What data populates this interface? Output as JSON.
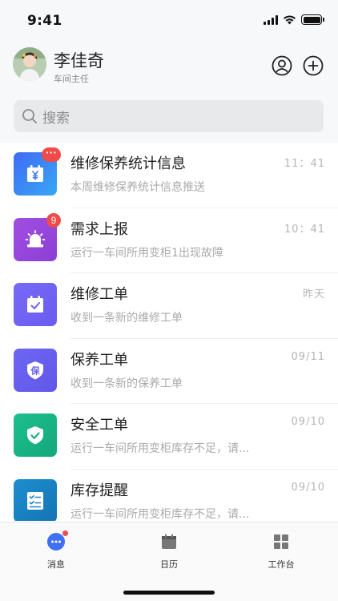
{
  "status_bar": {
    "time": "9:41"
  },
  "header": {
    "user_name": "李佳奇",
    "user_role": "车间主任"
  },
  "search": {
    "placeholder": "搜索"
  },
  "messages": [
    {
      "title": "维修保养统计信息",
      "subtitle": "本周维修保养统计信息推送",
      "time": "11：41",
      "badge": "···",
      "icon": "calendar-yen-icon",
      "color_from": "#3f6bf5",
      "color_to": "#38a7f4"
    },
    {
      "title": "需求上报",
      "subtitle": "运行一车间所用变柜1出现故障",
      "time": "10：41",
      "badge": "9",
      "icon": "alarm-light-icon",
      "color_from": "#a14ee0",
      "color_to": "#8b3fd6"
    },
    {
      "title": "维修工单",
      "subtitle": "收到一条新的维修工单",
      "time": "昨天",
      "badge": "",
      "icon": "calendar-check-icon",
      "color_from": "#7869f6",
      "color_to": "#6a5cf0"
    },
    {
      "title": "保养工单",
      "subtitle": "收到一条新的保养工单",
      "time": "09/11",
      "badge": "",
      "icon": "shield-bao-icon",
      "color_from": "#6e66f3",
      "color_to": "#6157e9"
    },
    {
      "title": "安全工单",
      "subtitle": "运行一车间所用变柜库存不足，请...",
      "time": "09/10",
      "badge": "",
      "icon": "shield-check-icon",
      "color_from": "#1dbf8e",
      "color_to": "#14a87c"
    },
    {
      "title": "库存提醒",
      "subtitle": "运行一车间所用变柜库存不足，请...",
      "time": "09/10",
      "badge": "",
      "icon": "checklist-icon",
      "color_from": "#1c8fd0",
      "color_to": "#1573b3"
    }
  ],
  "tabs": [
    {
      "label": "消息",
      "icon": "message-icon",
      "active": true
    },
    {
      "label": "日历",
      "icon": "calendar-icon",
      "active": false
    },
    {
      "label": "工作台",
      "icon": "workbench-icon",
      "active": false
    }
  ],
  "colors": {
    "accent": "#3e6ff5",
    "badge": "#f04a4a",
    "tab_inactive": "#777777"
  }
}
